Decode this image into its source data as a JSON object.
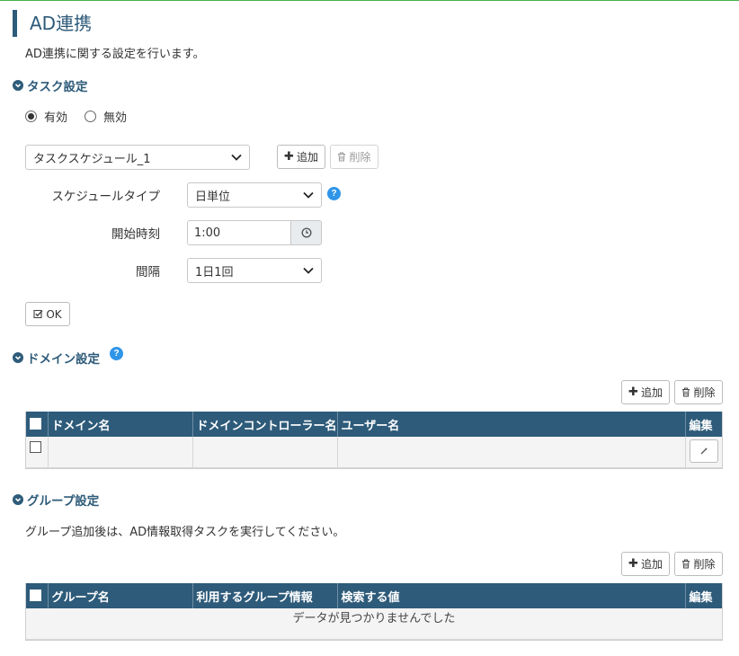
{
  "page": {
    "title": "AD連携",
    "description": "AD連携に関する設定を行います。"
  },
  "task": {
    "heading": "タスク設定",
    "enabled_label": "有効",
    "disabled_label": "無効",
    "selected": "enabled",
    "schedule_selected": "タスクスケジュール_1",
    "add_label": "追加",
    "delete_label": "削除",
    "schedule_type_label": "スケジュールタイプ",
    "schedule_type_value": "日単位",
    "start_time_label": "開始時刻",
    "start_time_value": "1:00",
    "interval_label": "間隔",
    "interval_value": "1日1回",
    "ok_label": "OK"
  },
  "domain": {
    "heading": "ドメイン設定",
    "add_label": "追加",
    "delete_label": "削除",
    "columns": [
      "ドメイン名",
      "ドメインコントローラー名",
      "ユーザー名",
      "編集"
    ]
  },
  "group": {
    "heading": "グループ設定",
    "note": "グループ追加後は、AD情報取得タスクを実行してください。",
    "add_label": "追加",
    "delete_label": "削除",
    "columns": [
      "グループ名",
      "利用するグループ情報",
      "検索する値",
      "編集"
    ],
    "empty_message": "データが見つかりませんでした"
  },
  "colors": {
    "header_bg": "#2e5b7a",
    "accent_green": "#46b14b",
    "help_blue": "#2f95e8"
  }
}
